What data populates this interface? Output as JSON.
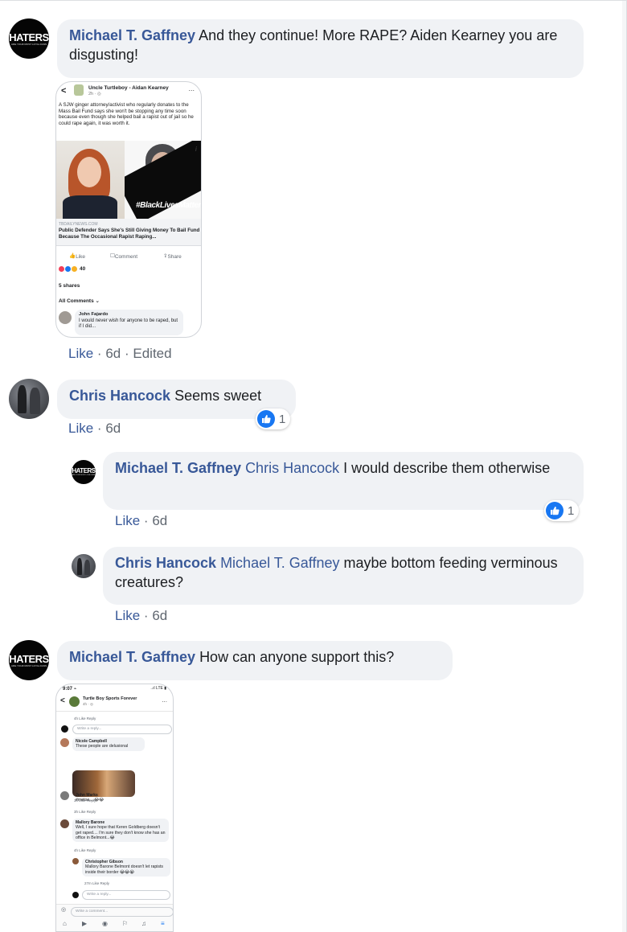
{
  "comments": [
    {
      "author": "Michael T. Gaffney",
      "text": "And they continue! More RAPE? Aiden Kearney you are disgusting!",
      "avatar": {
        "big": "HATERS",
        "small": "ARE YOUR MOST LOYAL FANS"
      },
      "like": "Like",
      "sep": "·",
      "time": "6d",
      "edited": "Edited"
    },
    {
      "author": "Chris Hancock",
      "text": "Seems sweet",
      "reaction_count": "1",
      "like": "Like",
      "sep": "·",
      "time": "6d"
    },
    {
      "author": "Michael T. Gaffney",
      "mention": "Chris Hancock",
      "text": "I would describe them otherwise",
      "avatar": {
        "big": "HATERS",
        "small": "ARE YOUR MOST LOYAL FANS"
      },
      "reaction_count": "1",
      "like": "Like",
      "sep": "·",
      "time": "6d"
    },
    {
      "author": "Chris Hancock",
      "mention": "Michael T. Gaffney",
      "text": "maybe bottom feeding verminous creatures?",
      "like": "Like",
      "sep": "·",
      "time": "6d"
    },
    {
      "author": "Michael T. Gaffney",
      "text": "How can anyone support this?",
      "avatar": {
        "big": "HATERS",
        "small": "ARE YOUR MOST LOYAL FANS"
      }
    }
  ],
  "shot1": {
    "back": "<",
    "page_name": "Uncle Turtleboy - Aidan Kearney",
    "page_sub": "2h · ◎",
    "dots": "...",
    "post_text": "A SJW ginger attorney/activist who regularly donates to the Mass Bail Fund says she won't be stopping any time soon because even though she helped bail a rapist out of jail so he could rape again, it was worth it.",
    "overlay": "#BlackLivesMatter",
    "info": "i",
    "link_domain": "TBDAILYNEWS.COM",
    "link_title": "Public Defender Says She's Still Giving Money To Bail Fund Because The Occasional Rapist Raping...",
    "actions": [
      "Like",
      "Comment",
      "Share"
    ],
    "reaction_count": "40",
    "shares": "5 shares",
    "all_comments": "All Comments ⌄",
    "comment_author": "John Fajardo",
    "comment_text": "I would never wish for anyone to be raped, but if I did..."
  },
  "shot2": {
    "time": "9:07 ⌁",
    "signal": "..ıl LTE ▮",
    "back": "<",
    "page_name": "Turtle Boy Sports Forever",
    "page_sub": "4h · ◎",
    "dots": "...",
    "meta_top": "4h   Like   Reply",
    "reply_ph": "Write a reply...",
    "c1_author": "Nicole Campbell",
    "c1_text": "These people are delusional",
    "c1_meta": "3h   Like   Reply",
    "c2_author": "John Marks",
    "c2_text": "#metoo....😂😂",
    "c2_meta": "3h   Like   Reply",
    "c3_author": "Mallory Barone",
    "c3_text": "Well, I sure hope that Keren Goldberg doesn't get raped.... I'm sure they don't know she has an office in Belmont...😂",
    "c3_meta": "4h   Like   Reply",
    "c4_author": "Christopher Gibson",
    "c4_text": "Mallory Barone Belmont doesn't let rapists inside their border 😂😂😭",
    "c4_meta": "27m   Like   Reply",
    "reply_ph2": "Write a reply...",
    "comment_ph": "Write a comment...",
    "nav": [
      "⌂",
      "▶",
      "◉",
      "⚐",
      "♫",
      "≡"
    ]
  }
}
